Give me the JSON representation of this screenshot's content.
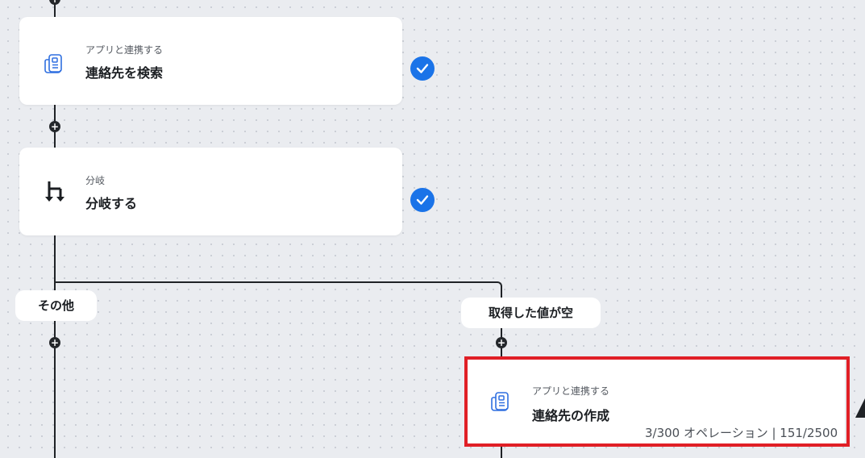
{
  "flow": {
    "steps": [
      {
        "id": "search-contacts",
        "category": "アプリと連携する",
        "title": "連絡先を検索",
        "icon": "document-app-icon",
        "completed": true
      },
      {
        "id": "branch",
        "category": "分岐",
        "title": "分岐する",
        "icon": "branch-icon",
        "completed": true
      },
      {
        "id": "create-contact",
        "category": "アプリと連携する",
        "title": "連絡先の作成",
        "icon": "document-app-icon",
        "highlighted": true
      }
    ],
    "branches": {
      "left_label": "その他",
      "right_label": "取得した値が空"
    },
    "add_symbol": "+"
  },
  "status_bar": {
    "text": "3/300 オペレーション | 151/2500"
  },
  "colors": {
    "check_blue": "#1a73e8",
    "highlight_red": "#e01f26",
    "connector": "#1f2226"
  }
}
